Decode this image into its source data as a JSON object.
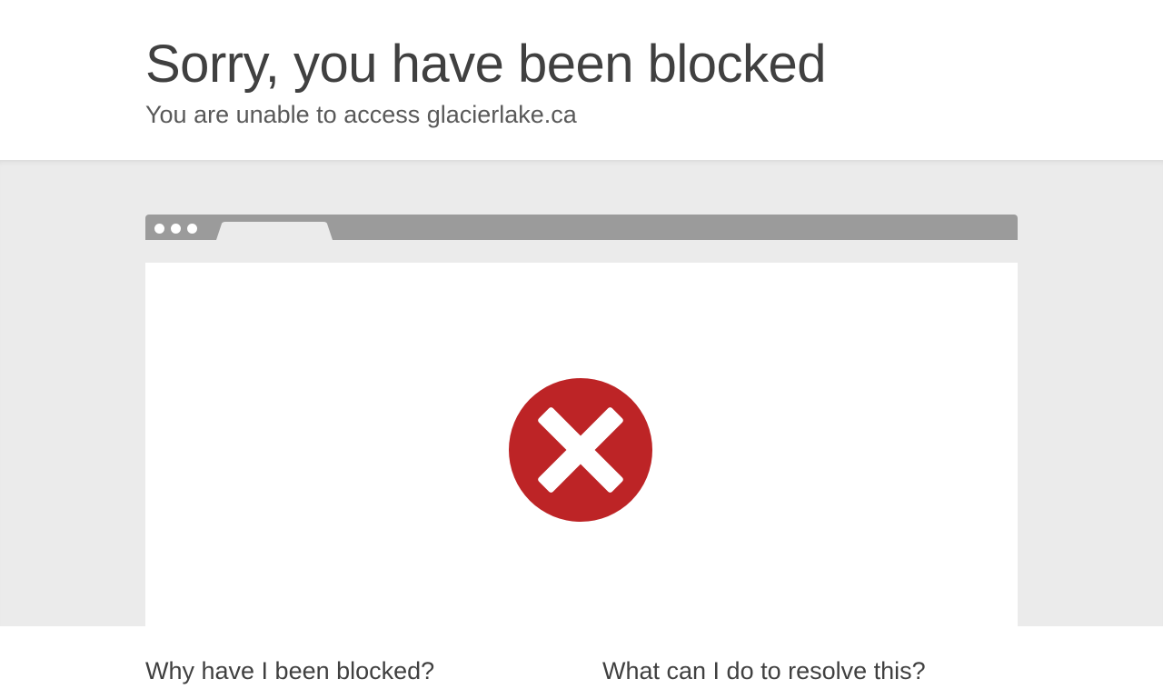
{
  "header": {
    "title": "Sorry, you have been blocked",
    "subtitle": "You are unable to access glacierlake.ca"
  },
  "illustration": {
    "window_dots_icon": "three-dots-icon",
    "browser_tab_icon": "browser-tab-icon",
    "status_icon": "blocked-x-circle-icon",
    "status_color": "#bd2426"
  },
  "sections": {
    "why_heading": "Why have I been blocked?",
    "resolve_heading": "What can I do to resolve this?"
  },
  "colors": {
    "band_background": "#ebebeb",
    "browser_bar": "#9b9b9b",
    "text": "#404040"
  }
}
